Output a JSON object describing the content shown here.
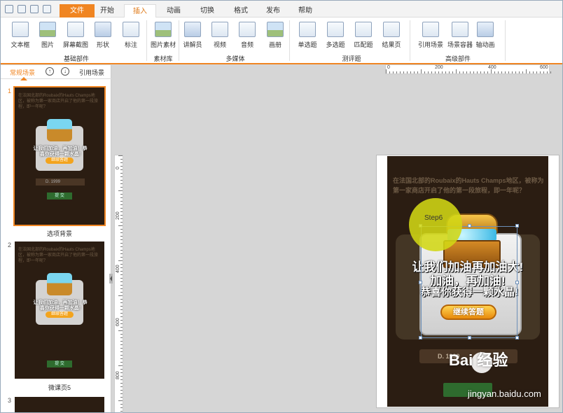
{
  "tabs": [
    "文件",
    "开始",
    "插入",
    "动画",
    "切换",
    "格式",
    "发布",
    "帮助"
  ],
  "ribbon": {
    "buttons": [
      "文本框",
      "图片",
      "屏幕截图",
      "形状",
      "标注",
      "图片素材",
      "讲解员",
      "视频",
      "音频",
      "画册",
      "单选题",
      "多选题",
      "匹配题",
      "结果页",
      "引用场景",
      "场景容器",
      "轴动画"
    ],
    "groups": [
      "基础部件",
      "素材库",
      "多媒体",
      "测评题",
      "高级部件"
    ]
  },
  "left_panel": {
    "tab_active": "常规场景",
    "tab_other": "引用场景",
    "up_icon": "↑",
    "down_icon": "↓",
    "slides": [
      {
        "num": "1",
        "caption": "选项背景"
      },
      {
        "num": "2",
        "caption": "微课页5"
      },
      {
        "num": "3",
        "caption": ""
      }
    ],
    "thumb_text": "在法国北部的Roubaix的Hauts Champs地区，被称为第一家商店开启了他的第一段旅程，即一年呢？",
    "thumb_msg": "让我们加油，再加油！恭喜你获得一颗水晶!",
    "thumb_btn": "继续答题",
    "thumb_opt": "D. 1999",
    "thumb_sub": "提 交"
  },
  "rulers": {
    "h_labels": [
      "0",
      "200",
      "400",
      "600"
    ],
    "v_labels": [
      "0",
      "200",
      "400",
      "600",
      "800"
    ]
  },
  "slide": {
    "text": "在法国北部的Roubaix的Hauts Champs地区，被称为第一家商店开启了他的第一段旅程，即一年呢？",
    "msg1": "让我们加油再加油大!",
    "msg2": "加油，再加油!",
    "msg3": "恭喜你获得一颗水晶!",
    "continue_btn": "继续答题",
    "option": "D. 1999",
    "step_label": "Step6"
  },
  "watermark": {
    "text": "Bai 经验",
    "url": "jingyan.baidu.com"
  },
  "colors": {
    "accent": "#f08522",
    "slide_bg": "#2b1d12"
  }
}
